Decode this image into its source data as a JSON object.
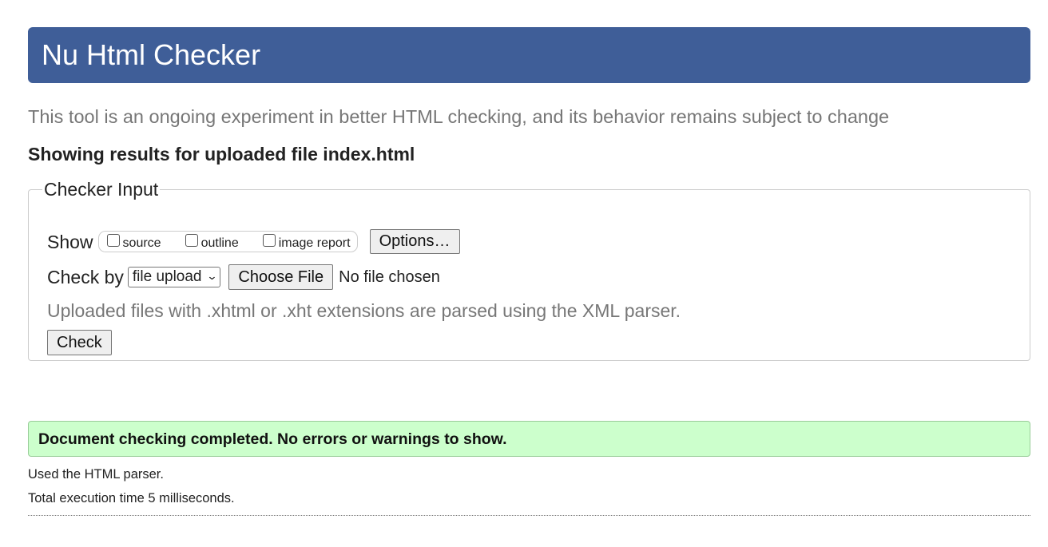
{
  "header": {
    "title": "Nu Html Checker"
  },
  "subtitle": "This tool is an ongoing experiment in better HTML checking, and its behavior remains subject to change",
  "results_heading": "Showing results for uploaded file index.html",
  "checker_input": {
    "legend": "Checker Input",
    "show": {
      "label": "Show",
      "options": [
        {
          "label": "source",
          "checked": false
        },
        {
          "label": "outline",
          "checked": false
        },
        {
          "label": "image report",
          "checked": false
        }
      ],
      "options_button": "Options…"
    },
    "check_by": {
      "label": "Check by",
      "selected": "file upload",
      "choose_file_button": "Choose File",
      "file_status": "No file chosen"
    },
    "note": "Uploaded files with .xhtml or .xht extensions are parsed using the XML parser.",
    "check_button": "Check"
  },
  "result": {
    "message": "Document checking completed. No errors or warnings to show.",
    "parser": "Used the HTML parser.",
    "execution_time": "Total execution time 5 milliseconds."
  },
  "colors": {
    "header_bg": "#3f5e98",
    "success_bg": "#ccffcc",
    "muted_text": "#777777"
  }
}
